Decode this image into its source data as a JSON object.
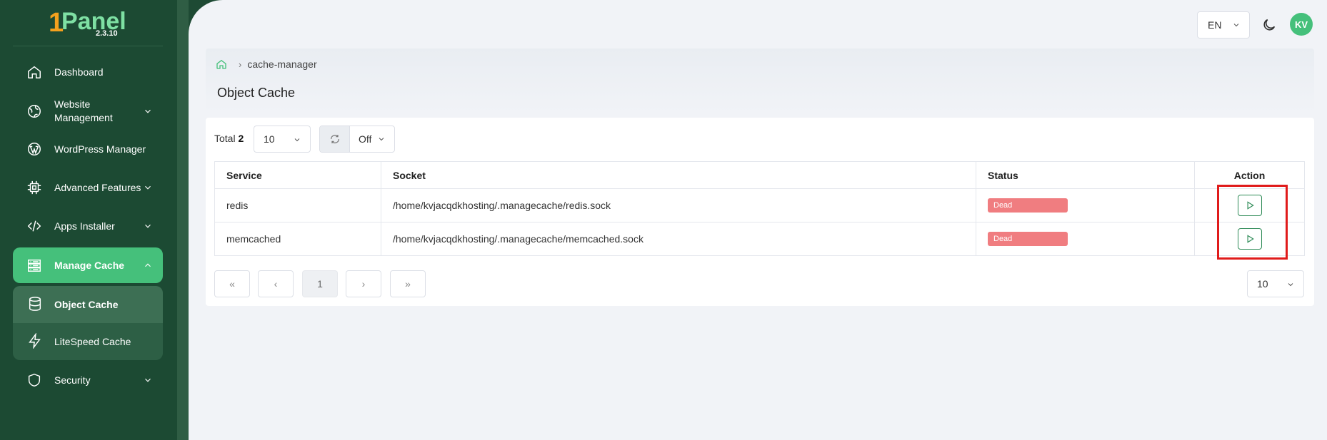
{
  "app": {
    "logo_mark": "1",
    "logo_text": "Panel",
    "version": "2.3.10"
  },
  "sidebar": {
    "items": [
      {
        "label": "Dashboard"
      },
      {
        "label": "Website Management"
      },
      {
        "label": "WordPress Manager"
      },
      {
        "label": "Advanced Features"
      },
      {
        "label": "Apps Installer"
      },
      {
        "label": "Manage Cache"
      },
      {
        "label": "Security"
      }
    ],
    "sub_items": [
      {
        "label": "Object Cache"
      },
      {
        "label": "LiteSpeed Cache"
      }
    ]
  },
  "topbar": {
    "language": "EN",
    "avatar_initials": "KV"
  },
  "breadcrumb": {
    "current": "cache-manager"
  },
  "page": {
    "title": "Object Cache"
  },
  "toolbar": {
    "total_label": "Total",
    "total_count": "2",
    "page_size": "10",
    "refresh_value": "Off"
  },
  "table": {
    "headers": [
      "Service",
      "Socket",
      "Status",
      "Action"
    ],
    "rows": [
      {
        "service": "redis",
        "socket": "/home/kvjacqdkhosting/.managecache/redis.sock",
        "status": "Dead"
      },
      {
        "service": "memcached",
        "socket": "/home/kvjacqdkhosting/.managecache/memcached.sock",
        "status": "Dead"
      }
    ]
  },
  "pagination": {
    "first": "«",
    "prev": "‹",
    "current": "1",
    "next": "›",
    "last": "»",
    "page_size": "10"
  },
  "colors": {
    "sidebar_bg": "#1c4a33",
    "accent": "#45c07b",
    "dead_badge": "#f07d80",
    "highlight": "#e01b1b"
  }
}
